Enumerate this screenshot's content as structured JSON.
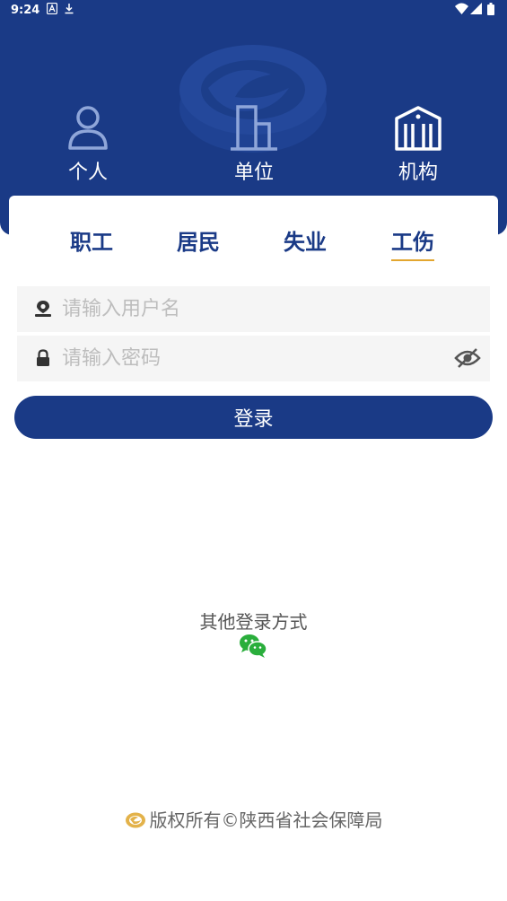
{
  "status_bar": {
    "time": "9:24"
  },
  "nav": {
    "items": [
      {
        "label": "个人"
      },
      {
        "label": "单位"
      },
      {
        "label": "机构"
      }
    ]
  },
  "tabs": [
    {
      "label": "职工"
    },
    {
      "label": "居民"
    },
    {
      "label": "失业"
    },
    {
      "label": "工伤",
      "active": true
    }
  ],
  "form": {
    "username_placeholder": "请输入用户名",
    "password_placeholder": "请输入密码",
    "login_label": "登录"
  },
  "other_login": {
    "label": "其他登录方式",
    "icon": "wechat-icon"
  },
  "footer": {
    "copyright": "版权所有©陕西省社会保障局"
  },
  "colors": {
    "primary": "#1a3a86",
    "accent": "#e3a62f",
    "wechat": "#2aae3c"
  }
}
